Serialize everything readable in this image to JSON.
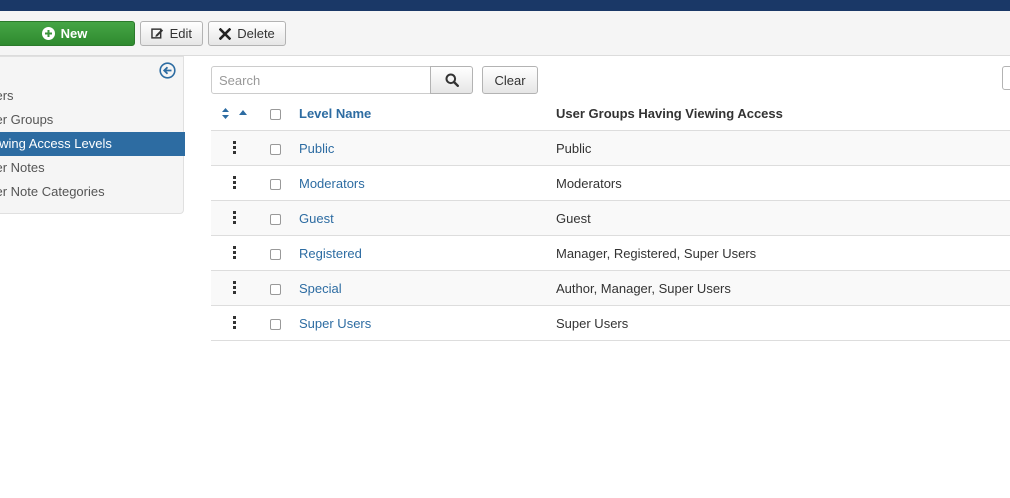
{
  "toolbar": {
    "new_label": "New",
    "edit_label": "Edit",
    "delete_label": "Delete"
  },
  "sidebar": {
    "items": [
      {
        "label": "sers",
        "active": false
      },
      {
        "label": "ser Groups",
        "active": false
      },
      {
        "label": "iewing Access Levels",
        "active": true
      },
      {
        "label": "ser Notes",
        "active": false
      },
      {
        "label": "ser Note Categories",
        "active": false
      }
    ]
  },
  "search": {
    "placeholder": "Search",
    "value": "",
    "clear_label": "Clear"
  },
  "table": {
    "columns": {
      "level_name": "Level Name",
      "groups": "User Groups Having Viewing Access"
    },
    "rows": [
      {
        "level": "Public",
        "groups": "Public"
      },
      {
        "level": "Moderators",
        "groups": "Moderators"
      },
      {
        "level": "Guest",
        "groups": "Guest"
      },
      {
        "level": "Registered",
        "groups": "Manager, Registered, Super Users"
      },
      {
        "level": "Special",
        "groups": "Author, Manager, Super Users"
      },
      {
        "level": "Super Users",
        "groups": "Super Users"
      }
    ]
  },
  "colors": {
    "topbar": "#1a3867",
    "new_button": "#3c9a3c",
    "active_sidebar": "#2d6ca2",
    "link": "#2d6ca2"
  }
}
